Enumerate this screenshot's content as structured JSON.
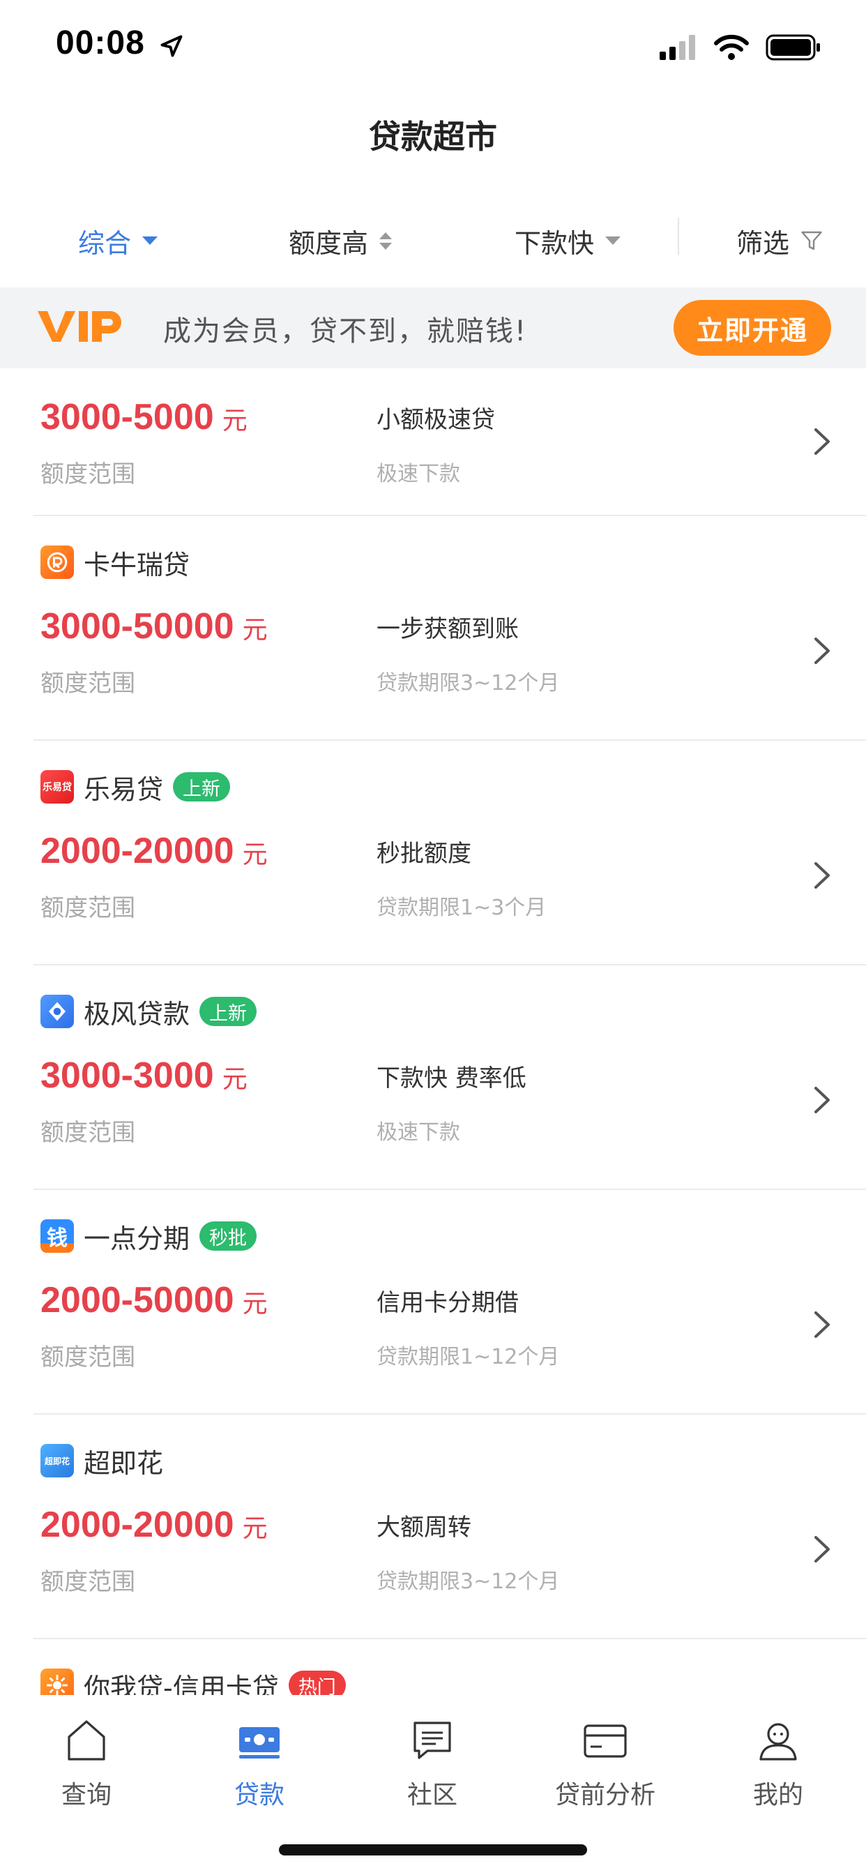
{
  "status": {
    "time": "00:08"
  },
  "nav": {
    "title": "贷款超市"
  },
  "filters": [
    {
      "label": "综合",
      "active": true
    },
    {
      "label": "额度高",
      "active": false
    },
    {
      "label": "下款快",
      "active": false
    },
    {
      "label": "筛选",
      "active": false
    }
  ],
  "vip": {
    "logo": "VIP",
    "text": "成为会员，贷不到，就赔钱!",
    "button": "立即开通",
    "accent": "#ff8a1a"
  },
  "colors": {
    "primary": "#3c7be0",
    "amount": "#e6414b",
    "tag_green": "#2dbb6e",
    "tag_red": "#ee3d3d"
  },
  "loans": [
    {
      "name": "",
      "icon": "",
      "tag": "",
      "amount": "3000-5000",
      "unit": "元",
      "amount_label": "额度范围",
      "title": "小额极速贷",
      "subtitle": "极速下款"
    },
    {
      "name": "卡牛瑞贷",
      "icon": "kaniu-app-icon",
      "tag": "",
      "amount": "3000-50000",
      "unit": "元",
      "amount_label": "额度范围",
      "title": "一步获额到账",
      "subtitle": "贷款期限3~12个月"
    },
    {
      "name": "乐易贷",
      "icon": "leyidai-app-icon",
      "icon_text": "乐易贷",
      "tag": "上新",
      "amount": "2000-20000",
      "unit": "元",
      "amount_label": "额度范围",
      "title": "秒批额度",
      "subtitle": "贷款期限1~3个月"
    },
    {
      "name": "极风贷款",
      "icon": "jifeng-app-icon",
      "tag": "上新",
      "amount": "3000-3000",
      "unit": "元",
      "amount_label": "额度范围",
      "title": "下款快 费率低",
      "subtitle": "极速下款"
    },
    {
      "name": "一点分期",
      "icon": "yidian-app-icon",
      "icon_text": "钱",
      "tag": "秒批",
      "amount": "2000-50000",
      "unit": "元",
      "amount_label": "额度范围",
      "title": "信用卡分期借",
      "subtitle": "贷款期限1~12个月"
    },
    {
      "name": "超即花",
      "icon": "chaojihua-app-icon",
      "icon_text": "超即花",
      "tag": "",
      "amount": "2000-20000",
      "unit": "元",
      "amount_label": "额度范围",
      "title": "大额周转",
      "subtitle": "贷款期限3~12个月"
    },
    {
      "name": "你我贷-信用卡贷",
      "icon": "niwodai-app-icon",
      "tag": "热门"
    }
  ],
  "tabs": [
    {
      "label": "查询",
      "icon": "home-icon",
      "active": false
    },
    {
      "label": "贷款",
      "icon": "loan-icon",
      "active": true
    },
    {
      "label": "社区",
      "icon": "community-icon",
      "active": false
    },
    {
      "label": "贷前分析",
      "icon": "card-analysis-icon",
      "active": false
    },
    {
      "label": "我的",
      "icon": "profile-icon",
      "active": false
    }
  ]
}
